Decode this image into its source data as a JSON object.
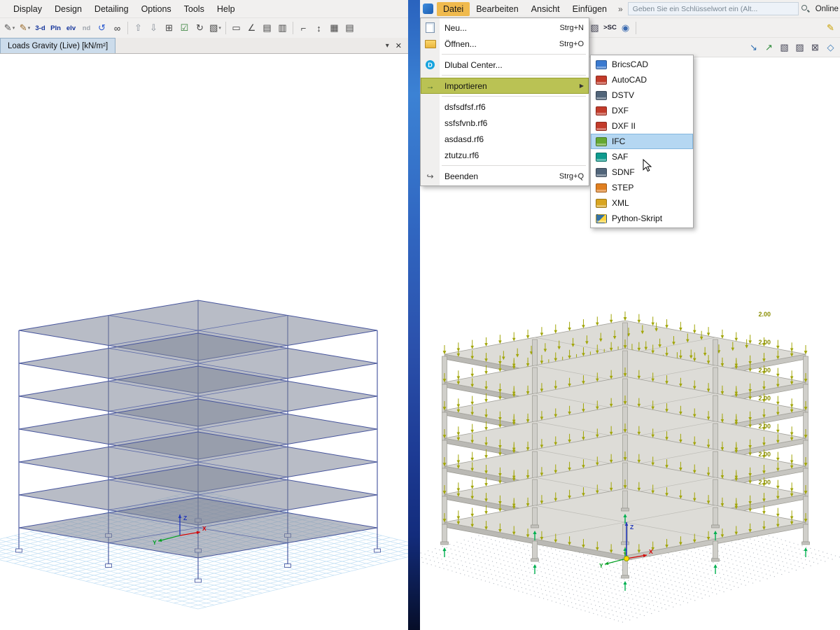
{
  "left_window": {
    "menu_items": [
      "Display",
      "Design",
      "Detailing",
      "Options",
      "Tools",
      "Help"
    ],
    "toolbar": [
      {
        "name": "format-pen-icon",
        "glyph": "✎",
        "color": "#555",
        "caret": true
      },
      {
        "name": "format-brush-icon",
        "glyph": "✎",
        "color": "#9a6a2a",
        "caret": true
      },
      {
        "name": "view-3d-button",
        "glyph": "3-d",
        "color": "#13339a",
        "small": true
      },
      {
        "name": "plan-view-button",
        "glyph": "Pln",
        "color": "#13339a",
        "small": true
      },
      {
        "name": "elevation-view-button",
        "glyph": "elv",
        "color": "#13339a",
        "small": true
      },
      {
        "name": "nd-view-button",
        "glyph": "nd",
        "color": "#a0a6ae",
        "small": true
      },
      {
        "name": "undo-icon",
        "glyph": "↺",
        "color": "#2a5ad0"
      },
      {
        "name": "view-glasses-icon",
        "glyph": "∞",
        "color": "#333"
      },
      {
        "type": "sep"
      },
      {
        "name": "move-up-icon",
        "glyph": "⇧",
        "color": "#8a929c"
      },
      {
        "name": "move-down-icon",
        "glyph": "⇩",
        "color": "#8a929c"
      },
      {
        "name": "window-select-icon",
        "glyph": "⊞",
        "color": "#444"
      },
      {
        "name": "checkbox-icon",
        "glyph": "☑",
        "color": "#2e7d32"
      },
      {
        "name": "rotate-view-icon",
        "glyph": "↻",
        "color": "#444"
      },
      {
        "name": "isometric-view-icon",
        "glyph": "▧",
        "color": "#444",
        "caret": true
      },
      {
        "type": "sep"
      },
      {
        "name": "rectangle-tool-icon",
        "glyph": "▭",
        "color": "#444"
      },
      {
        "name": "angle-tool-icon",
        "glyph": "∠",
        "color": "#444"
      },
      {
        "name": "hatch-tool-icon",
        "glyph": "▤",
        "color": "#444"
      },
      {
        "name": "hatch-alt-tool-icon",
        "glyph": "▥",
        "color": "#444"
      },
      {
        "type": "sep"
      },
      {
        "name": "corner-tool-icon",
        "glyph": "⌐",
        "color": "#444"
      },
      {
        "name": "vertical-dim-icon",
        "glyph": "↕",
        "color": "#444"
      },
      {
        "name": "section-table-icon",
        "glyph": "▦",
        "color": "#444"
      },
      {
        "name": "table-view-icon",
        "glyph": "▤",
        "color": "#444"
      }
    ],
    "tab": {
      "label": "Loads Gravity  (Live)  [kN/m²]"
    },
    "tab_controls": {
      "dropdown_glyph": "▾",
      "close_glyph": "✕"
    },
    "axes": {
      "x": "X",
      "y": "Y",
      "z": "Z"
    }
  },
  "right_window": {
    "menu_items": [
      {
        "label": "Datei",
        "active": true
      },
      {
        "label": "Bearbeiten"
      },
      {
        "label": "Ansicht"
      },
      {
        "label": "Einfügen"
      }
    ],
    "overflow_glyph": "»",
    "search": {
      "placeholder": "Geben Sie ein Schlüsselwort ein (Alt..."
    },
    "license_label": "Online Lizenz...",
    "toolbar_main": [
      {
        "name": "clipboard-icon",
        "glyph": "▱",
        "color": "#667"
      },
      {
        "name": "new-file-icon",
        "glyph": "▢",
        "color": "#667"
      },
      {
        "name": "open-file-icon",
        "glyph": "▰",
        "color": "#c49327"
      },
      {
        "name": "printer-icon",
        "glyph": "⊟",
        "color": "#667"
      },
      {
        "type": "sep"
      },
      {
        "name": "undo-icon",
        "glyph": "↶",
        "color": "#2a5ad0",
        "caret": true
      },
      {
        "name": "redo-icon",
        "glyph": "↷",
        "color": "#a0a8b0",
        "caret": true
      },
      {
        "type": "sep"
      },
      {
        "name": "tables-icon",
        "glyph": "▦",
        "color": "#445"
      },
      {
        "name": "grid-table-icon",
        "glyph": "⊞",
        "color": "#445"
      },
      {
        "name": "section-properties-icon",
        "glyph": "I",
        "color": "#445",
        "bold": true
      },
      {
        "name": "load-cases-icon",
        "glyph": "▧",
        "color": "#445"
      },
      {
        "name": "results-icon",
        "glyph": "▨",
        "color": "#445"
      },
      {
        "name": "script-badge",
        "glyph": ">SC",
        "color": "#223",
        "small": true
      },
      {
        "name": "render-sphere-icon",
        "glyph": "◉",
        "color": "#3a6ab0"
      },
      {
        "type": "sep"
      },
      {
        "name": "edit-pencil-icon",
        "glyph": "✎",
        "color": "#c9a000",
        "push": true
      }
    ],
    "toolbar_view": [
      {
        "name": "axes-cross-icon",
        "glyph": "×",
        "color": "#c9a800",
        "caret": true,
        "bold": true
      },
      {
        "name": "snap-cross-icon",
        "glyph": "+",
        "color": "#2e8b3a",
        "caret": true,
        "bold": true
      },
      {
        "name": "view-cube-icon",
        "glyph": "◆",
        "color": "#3a7ab8",
        "caret": true
      },
      {
        "name": "display-options-icon",
        "glyph": "▦",
        "color": "#7a5ab0",
        "caret": true
      },
      {
        "name": "render-mode-icon",
        "glyph": "◪",
        "color": "#556"
      },
      {
        "name": "pointer-mode-icon",
        "glyph": "↖",
        "color": "#222",
        "caret": true
      },
      {
        "type": "sep"
      },
      {
        "name": "select-arrow-blue-icon",
        "glyph": "↘",
        "color": "#2b6cb0",
        "push": true
      },
      {
        "name": "select-arrow-green-icon",
        "glyph": "↗",
        "color": "#2e8b3a"
      },
      {
        "name": "visibility-icon",
        "glyph": "▧",
        "color": "#445"
      },
      {
        "name": "section-cut-icon",
        "glyph": "▨",
        "color": "#445"
      },
      {
        "name": "clip-box-icon",
        "glyph": "⊠",
        "color": "#445"
      },
      {
        "name": "workplane-icon",
        "glyph": "◇",
        "color": "#3a7ab8"
      }
    ],
    "file_menu": {
      "items": [
        {
          "label": "Neu...",
          "shortcut": "Strg+N",
          "icon": "new-document-icon",
          "kind": "page"
        },
        {
          "label": "Öffnen...",
          "shortcut": "Strg+O",
          "icon": "open-folder-icon",
          "kind": "folder"
        },
        {
          "type": "separator"
        },
        {
          "label": "Dlubal Center...",
          "icon": "dlubal-center-icon",
          "kind": "dlubal",
          "glyph": "D"
        },
        {
          "type": "separator"
        },
        {
          "label": "Importieren",
          "icon": "import-icon",
          "kind": "import",
          "glyph": "→",
          "highlighted": true,
          "submenu": true
        },
        {
          "type": "separator"
        },
        {
          "label": "dsfsdfsf.rf6",
          "icon": "recent-file"
        },
        {
          "label": "ssfsfvnb.rf6",
          "icon": "recent-file"
        },
        {
          "label": "asdasd.rf6",
          "icon": "recent-file"
        },
        {
          "label": "ztutzu.rf6",
          "icon": "recent-file"
        },
        {
          "type": "separator"
        },
        {
          "label": "Beenden",
          "shortcut": "Strg+Q",
          "icon": "exit-icon",
          "kind": "exit",
          "glyph": "↪"
        }
      ]
    },
    "import_submenu": {
      "items": [
        {
          "label": "BricsCAD",
          "color": "#3a7ad0"
        },
        {
          "label": "AutoCAD",
          "color": "#c23b2a"
        },
        {
          "label": "DSTV",
          "color": "#51657a"
        },
        {
          "label": "DXF",
          "color": "#c23b2a"
        },
        {
          "label": "DXF II",
          "color": "#c23b2a"
        },
        {
          "label": "IFC",
          "color": "#64a832",
          "highlighted": true
        },
        {
          "label": "SAF",
          "color": "#0f9b8e"
        },
        {
          "label": "SDNF",
          "color": "#51657a"
        },
        {
          "label": "STEP",
          "color": "#e07f20"
        },
        {
          "label": "XML",
          "color": "#d9a520"
        },
        {
          "label": "Python-Skript",
          "color": "#3572A5",
          "color2": "#ffd43b"
        }
      ]
    },
    "load_labels": [
      "2.00",
      "2.00",
      "2.00",
      "2.00",
      "2.00",
      "2.00",
      "2.00"
    ],
    "axes": {
      "x": "X",
      "y": "Y",
      "z": "Z"
    }
  }
}
